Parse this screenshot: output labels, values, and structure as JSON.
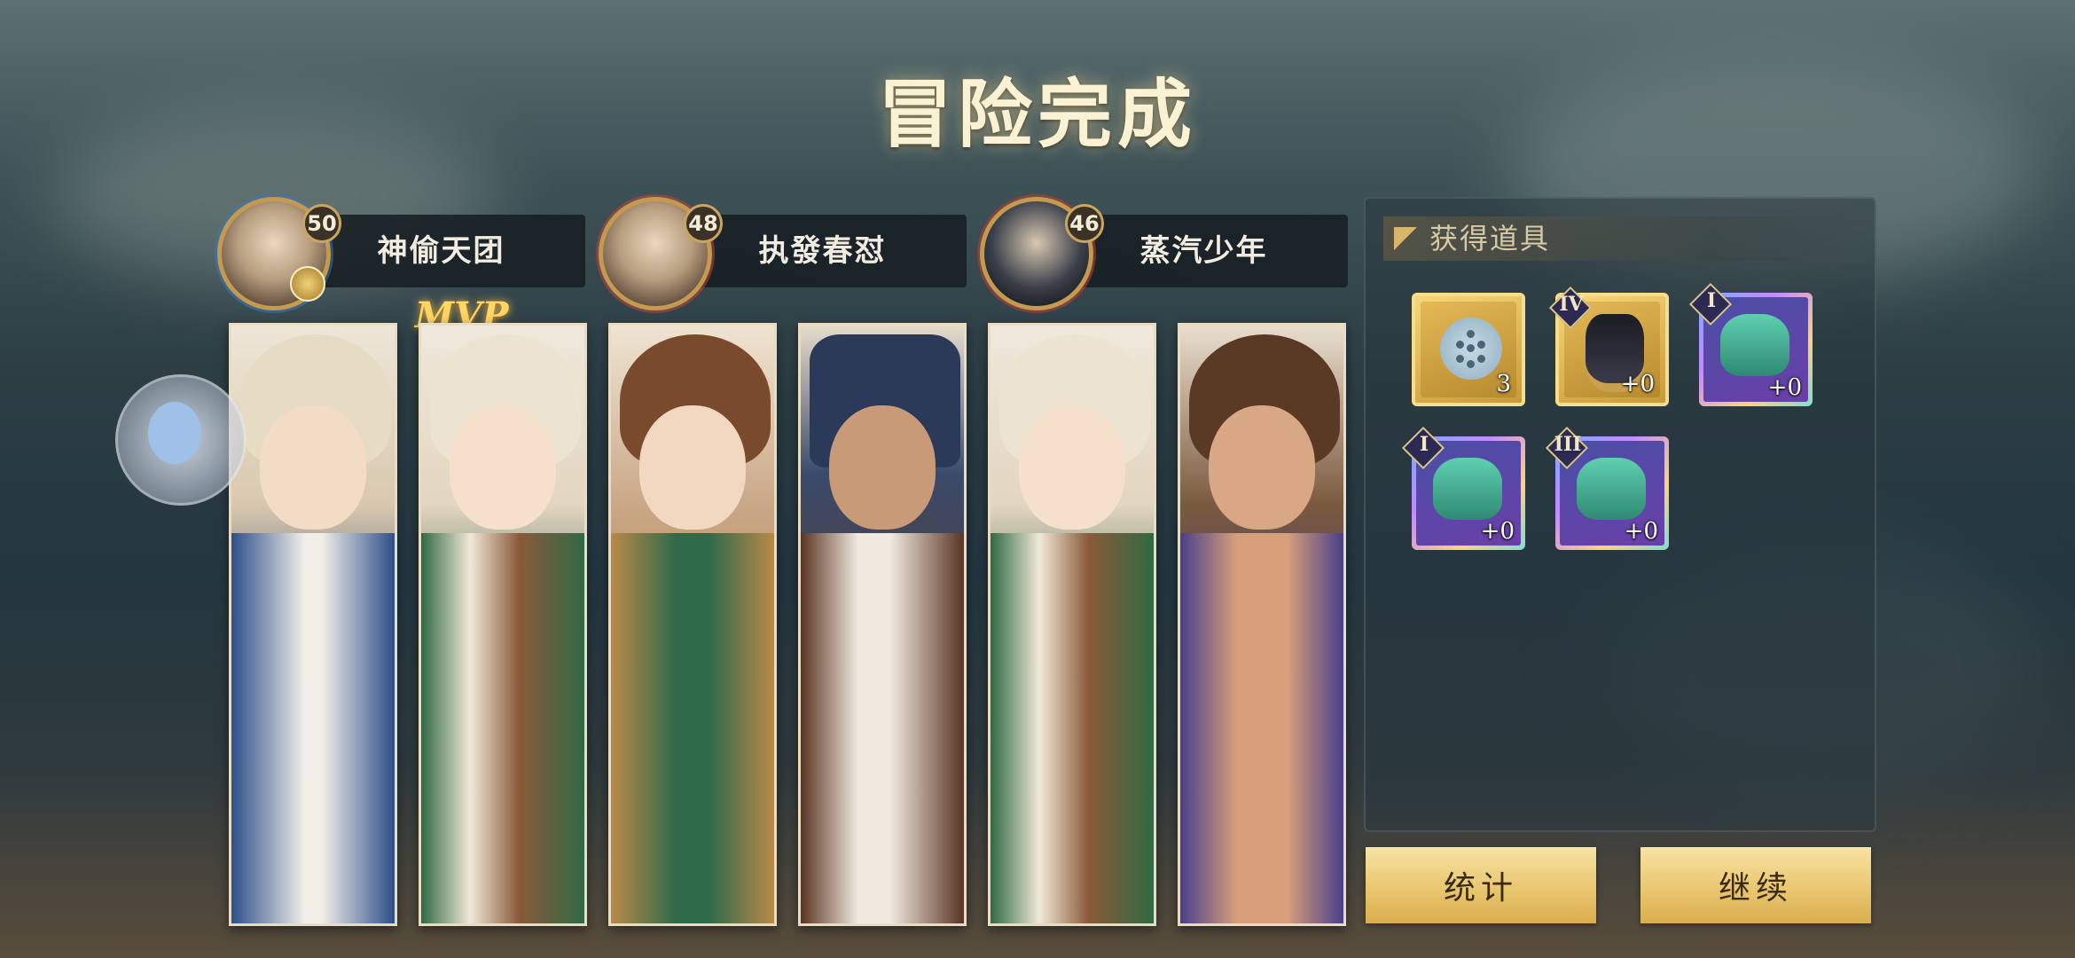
{
  "title": "冒险完成",
  "players": [
    {
      "name": "神偷天团",
      "level": "50"
    },
    {
      "name": "执發春怼",
      "level": "48"
    },
    {
      "name": "蒸汽少年",
      "level": "46"
    }
  ],
  "mvp_label": "MVP",
  "rewards": {
    "header": "获得道具",
    "items": [
      {
        "icon": "disc-icon",
        "rank": "",
        "qty": "3"
      },
      {
        "icon": "anubis-mask-icon",
        "rank": "IV",
        "qty": "+0"
      },
      {
        "icon": "jade-mask-icon",
        "rank": "I",
        "qty": "+0"
      },
      {
        "icon": "jade-mask-icon",
        "rank": "I",
        "qty": "+0"
      },
      {
        "icon": "jade-mask-icon",
        "rank": "III",
        "qty": "+0"
      }
    ]
  },
  "buttons": {
    "stats": "统计",
    "continue": "继续"
  },
  "colors": {
    "accent_gold": "#e7c46c",
    "title": "#fbf2d4"
  }
}
